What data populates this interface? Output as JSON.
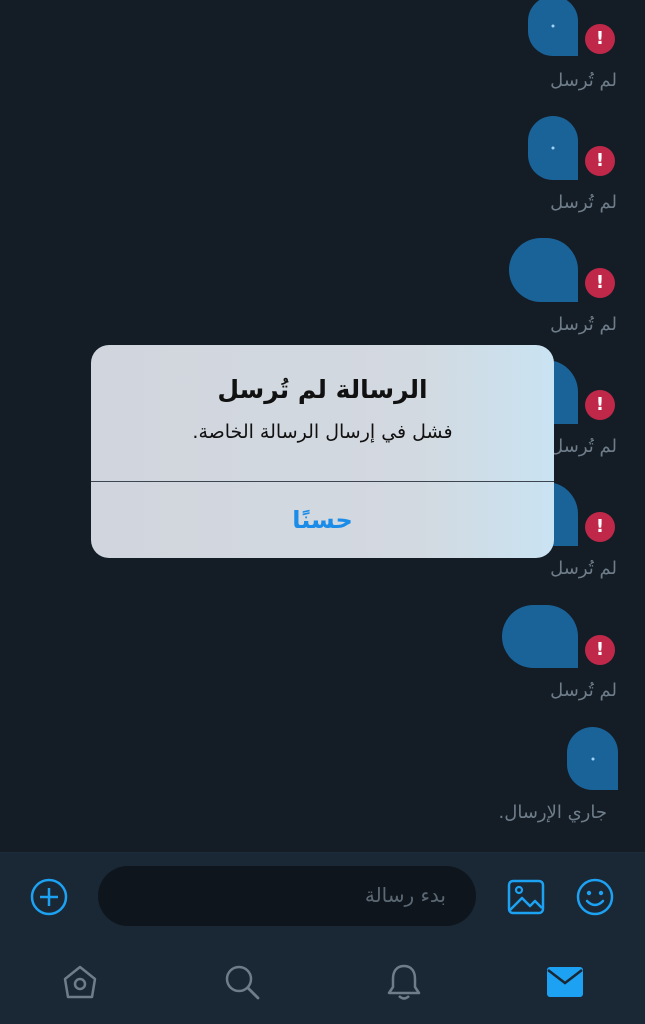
{
  "messages": [
    {
      "status": "لم تُرسل",
      "failed": true
    },
    {
      "status": "لم تُرسل",
      "failed": true
    },
    {
      "status": "لم تُرسل",
      "failed": true
    },
    {
      "status": "لم تُرسل",
      "failed": true
    },
    {
      "status": "لم تُرسل",
      "failed": true
    },
    {
      "status": "لم تُرسل",
      "failed": true
    },
    {
      "status": "جاري الإرسال.",
      "failed": false
    }
  ],
  "composer": {
    "placeholder": "بدء رسالة",
    "icons": [
      "add-icon",
      "image-icon",
      "emoji-icon"
    ]
  },
  "tabbar": {
    "items": [
      "home-icon",
      "search-icon",
      "notifications-icon",
      "messages-icon"
    ],
    "active": "messages-icon"
  },
  "alert": {
    "title": "الرسالة لم تُرسل",
    "message": "فشل في إرسال الرسالة الخاصة.",
    "ok_label": "حسنًا"
  },
  "colors": {
    "background": "#141d26",
    "bubble": "#1a6399",
    "error": "#c0284a",
    "accent": "#1da1f2",
    "alert_button": "#1b8ce8"
  }
}
